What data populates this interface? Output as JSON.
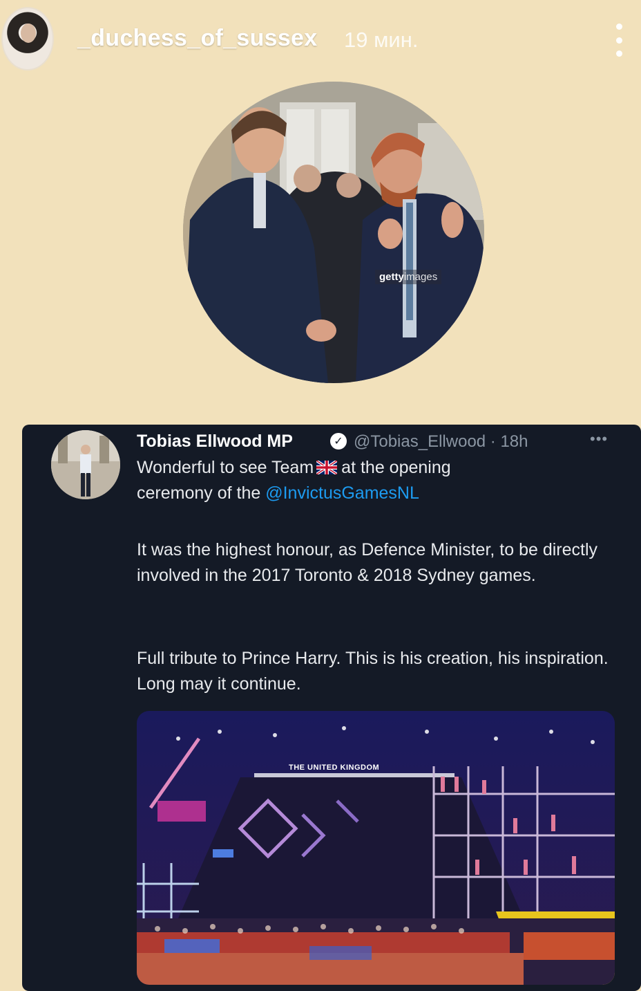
{
  "story": {
    "username": "_duchess_of_sussex",
    "time": "19 мин.",
    "avatar_icon": "profile-avatar",
    "menu_icon": "more-vertical-icon"
  },
  "photo": {
    "watermark_brand": "getty",
    "watermark_suffix": "images"
  },
  "tweet": {
    "author_name": "Tobias Ellwood MP",
    "handle_time": "@Tobias_Ellwood · 18h",
    "verified_icon": "verified-badge-icon",
    "more_icon": "more-horizontal-icon",
    "line1_pre": "Wonderful to see Team",
    "line1_post": "at the opening",
    "line2_pre": "ceremony of the ",
    "mention": "@InvictusGamesNL",
    "paragraph2": "It was the highest honour, as  Defence Minister, to be directly involved in the 2017 Toronto &  2018 Sydney games.",
    "paragraph3": "Full tribute to Prince Harry. This is his creation, his inspiration. Long may it continue.",
    "media_stage_text": "THE UNITED KINGDOM"
  },
  "colors": {
    "story_background": "#f2e1bb",
    "card_background": "#141a26",
    "link": "#1d9bf0",
    "muted": "#8b96a3"
  }
}
